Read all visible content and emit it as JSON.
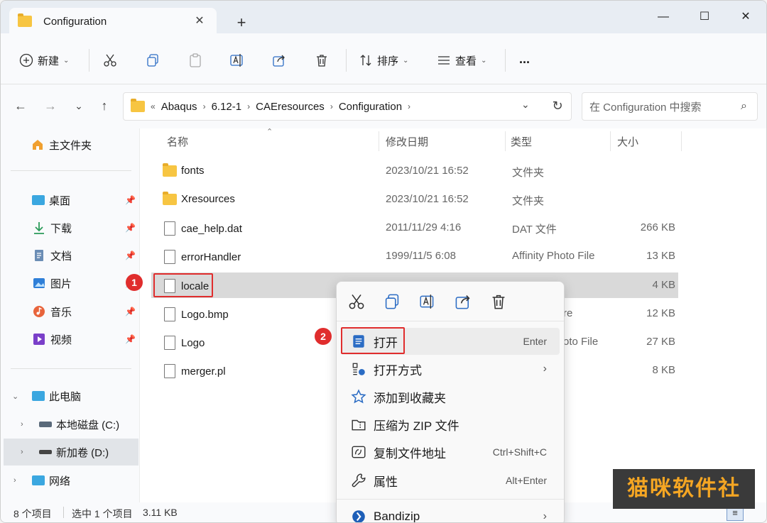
{
  "tab": {
    "title": "Configuration"
  },
  "toolbar": {
    "new_label": "新建",
    "sort_label": "排序",
    "view_label": "查看",
    "more_label": "..."
  },
  "address": {
    "overflow": "«",
    "crumbs": [
      "Abaqus",
      "6.12-1",
      "CAEresources",
      "Configuration"
    ]
  },
  "search": {
    "placeholder": "在 Configuration 中搜索"
  },
  "sidebar": {
    "home": "主文件夹",
    "quick": [
      {
        "label": "桌面",
        "icon": "desktop-icon"
      },
      {
        "label": "下载",
        "icon": "download-icon"
      },
      {
        "label": "文档",
        "icon": "document-icon"
      },
      {
        "label": "图片",
        "icon": "picture-icon"
      },
      {
        "label": "音乐",
        "icon": "music-icon"
      },
      {
        "label": "视频",
        "icon": "video-icon"
      }
    ],
    "this_pc": "此电脑",
    "drive_c": "本地磁盘 (C:)",
    "drive_d": "新加卷 (D:)",
    "network": "网络"
  },
  "columns": {
    "name": "名称",
    "modified": "修改日期",
    "type": "类型",
    "size": "大小"
  },
  "files": [
    {
      "name": "fonts",
      "date": "2023/10/21 16:52",
      "type": "文件夹",
      "size": "",
      "kind": "folder"
    },
    {
      "name": "Xresources",
      "date": "2023/10/21 16:52",
      "type": "文件夹",
      "size": "",
      "kind": "folder"
    },
    {
      "name": "cae_help.dat",
      "date": "2011/11/29 4:16",
      "type": "DAT 文件",
      "size": "266 KB",
      "kind": "file"
    },
    {
      "name": "errorHandler",
      "date": "1999/11/5 6:08",
      "type": "Affinity Photo File",
      "size": "13 KB",
      "kind": "file"
    },
    {
      "name": "locale",
      "date": "",
      "type": "",
      "size": "4 KB",
      "kind": "file"
    },
    {
      "name": "Logo.bmp",
      "date": "",
      "type": "re",
      "size": "12 KB",
      "kind": "file"
    },
    {
      "name": "Logo",
      "date": "",
      "type": "oto File",
      "size": "27 KB",
      "kind": "file"
    },
    {
      "name": "merger.pl",
      "date": "",
      "type": "",
      "size": "8 KB",
      "kind": "file"
    }
  ],
  "context_menu": {
    "open": {
      "label": "打开",
      "shortcut": "Enter"
    },
    "open_with": {
      "label": "打开方式"
    },
    "favorite": {
      "label": "添加到收藏夹"
    },
    "zip": {
      "label": "压缩为 ZIP 文件"
    },
    "copy_path": {
      "label": "复制文件地址",
      "shortcut": "Ctrl+Shift+C"
    },
    "properties": {
      "label": "属性",
      "shortcut": "Alt+Enter"
    },
    "bandizip": {
      "label": "Bandizip"
    }
  },
  "status": {
    "count": "8 个项目",
    "selection": "选中 1 个项目",
    "size": "3.11 KB"
  },
  "annotations": {
    "badge1": "1",
    "badge2": "2"
  },
  "watermark": "猫咪软件社",
  "colors": {
    "accent": "#e02d2d",
    "folder": "#f7c542",
    "selected_row": "#d9d9d9"
  }
}
